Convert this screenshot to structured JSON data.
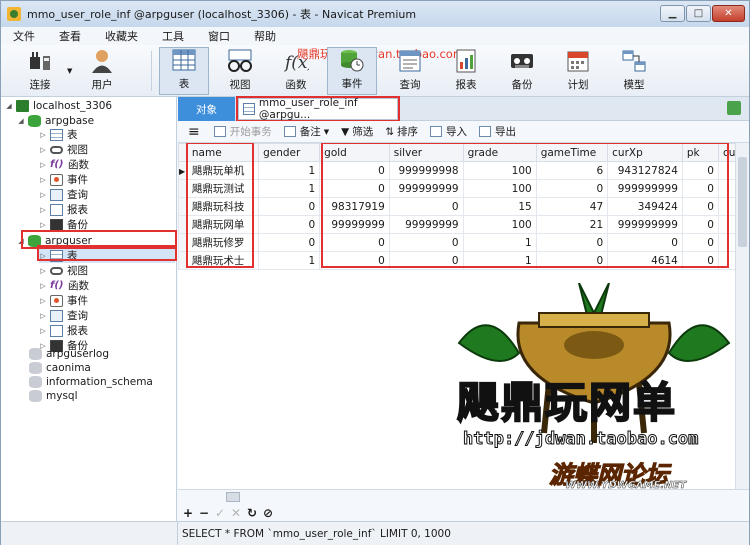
{
  "window": {
    "title": "mmo_user_role_inf @arpguser (localhost_3306) - 表 - Navicat Premium"
  },
  "menu": [
    "文件",
    "查看",
    "收藏夹",
    "工具",
    "窗口",
    "帮助"
  ],
  "watermark_top": "飓鼎玩网单 jdwan.taobao.com",
  "toolbar": {
    "connect": "连接",
    "user": "用户",
    "table": "表",
    "view": "视图",
    "function": "函数",
    "event": "事件",
    "query": "查询",
    "report": "报表",
    "backup": "备份",
    "schedule": "计划",
    "model": "模型"
  },
  "sidebar": {
    "connection": "localhost_3306",
    "db1": {
      "name": "arpgbase",
      "children": [
        "表",
        "视图",
        "函数",
        "事件",
        "查询",
        "报表",
        "备份"
      ]
    },
    "db2": {
      "name": "arpguser",
      "children": [
        "表",
        "视图",
        "函数",
        "事件",
        "查询",
        "报表",
        "备份"
      ]
    },
    "other_dbs": [
      "arpguserlog",
      "caonima",
      "information_schema",
      "mysql"
    ]
  },
  "tabs": {
    "objects": "对象",
    "table_tab": "mmo_user_role_inf @arpgu..."
  },
  "subtoolbar": {
    "begin_transaction": "开始事务",
    "note": "备注",
    "filter": "筛选",
    "sort": "排序",
    "import": "导入",
    "export": "导出"
  },
  "grid": {
    "columns": [
      "name",
      "gender",
      "gold",
      "silver",
      "grade",
      "gameTime",
      "curXp",
      "pk",
      "curH"
    ],
    "rows": [
      [
        "飓鼎玩单机",
        "1",
        "0",
        "999999998",
        "100",
        "6",
        "943127824",
        "0",
        ""
      ],
      [
        "飓鼎玩测试",
        "1",
        "0",
        "999999999",
        "100",
        "0",
        "999999999",
        "0",
        ""
      ],
      [
        "飓鼎玩科技",
        "0",
        "98317919",
        "0",
        "15",
        "47",
        "349424",
        "0",
        ""
      ],
      [
        "飓鼎玩网单",
        "0",
        "99999999",
        "99999999",
        "100",
        "21",
        "999999999",
        "0",
        ""
      ],
      [
        "飓鼎玩修罗",
        "0",
        "0",
        "0",
        "1",
        "0",
        "0",
        "0",
        ""
      ],
      [
        "飓鼎玩术士",
        "1",
        "0",
        "0",
        "1",
        "0",
        "4614",
        "0",
        ""
      ]
    ]
  },
  "logo": {
    "name": "飓鼎玩网单",
    "url": "http://jdwan.taobao.com",
    "site_name": "游蝶网论坛",
    "site_url": "WWW.YDWGAME.NET"
  },
  "navbar": [
    "+",
    "−",
    "✓",
    "✕",
    "↻",
    "⊘"
  ],
  "status": {
    "sql": "SELECT * FROM `mmo_user_role_inf` LIMIT 0, 1000"
  }
}
